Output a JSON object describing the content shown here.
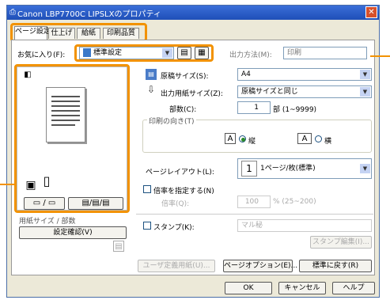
{
  "window": {
    "title": "Canon LBP7700C LIPSLXのプロパティ",
    "close_glyph": "✕"
  },
  "tabs": [
    {
      "label": "ページ設定",
      "active": true
    },
    {
      "label": "仕上げ",
      "active": false
    },
    {
      "label": "給紙",
      "active": false
    },
    {
      "label": "印刷品質",
      "active": false
    }
  ],
  "favorites": {
    "label": "お気に入り(F):",
    "selected": "標準設定"
  },
  "output_method": {
    "label": "出力方法(M):",
    "selected": "印刷"
  },
  "settings": {
    "page_size_label": "原稿サイズ(S):",
    "page_size_value": "A4",
    "output_size_label": "出力用紙サイズ(Z):",
    "output_size_value": "原稿サイズと同じ",
    "copies_label": "部数(C):",
    "copies_value": "1",
    "copies_unit": "部 (1~9999)",
    "orientation_label": "印刷の向き(T)",
    "orientation_portrait": "縦",
    "orientation_landscape": "横",
    "orientation_selected": "portrait",
    "page_layout_label": "ページレイアウト(L):",
    "page_layout_number": "1",
    "page_layout_value": "1ページ/枚(標準)",
    "manual_scale_label": "倍率を指定する(N)",
    "manual_scale_checked": false,
    "scale_label": "倍率(Q):",
    "scale_value": "100",
    "scale_unit": "% (25~200)",
    "stamp_label": "スタンプ(K):",
    "stamp_checked": false,
    "stamp_value": "マル秘",
    "edit_stamp_button": "スタンプ編集(I)..."
  },
  "left": {
    "section_label": "用紙サイズ / 部数",
    "check_settings_button": "設定確認(V)"
  },
  "bottom_buttons": {
    "custom_paper": "ユーザ定義用紙(U)...",
    "page_options": "ページオプション(E)...",
    "restore_defaults": "標準に戻す(R)"
  },
  "dialog_buttons": {
    "ok": "OK",
    "cancel": "キャンセル",
    "help": "ヘルプ"
  },
  "colors": {
    "highlight": "#f29200",
    "titlebar": "#2a5cc8"
  },
  "icons": [
    "printer-icon",
    "favorite-doc-icon",
    "add-favorite-icon",
    "edit-favorite-icon",
    "page-size-icon",
    "output-size-icon",
    "portrait-icon",
    "landscape-icon",
    "stack-icon",
    "page-icon",
    "layout-icon"
  ]
}
